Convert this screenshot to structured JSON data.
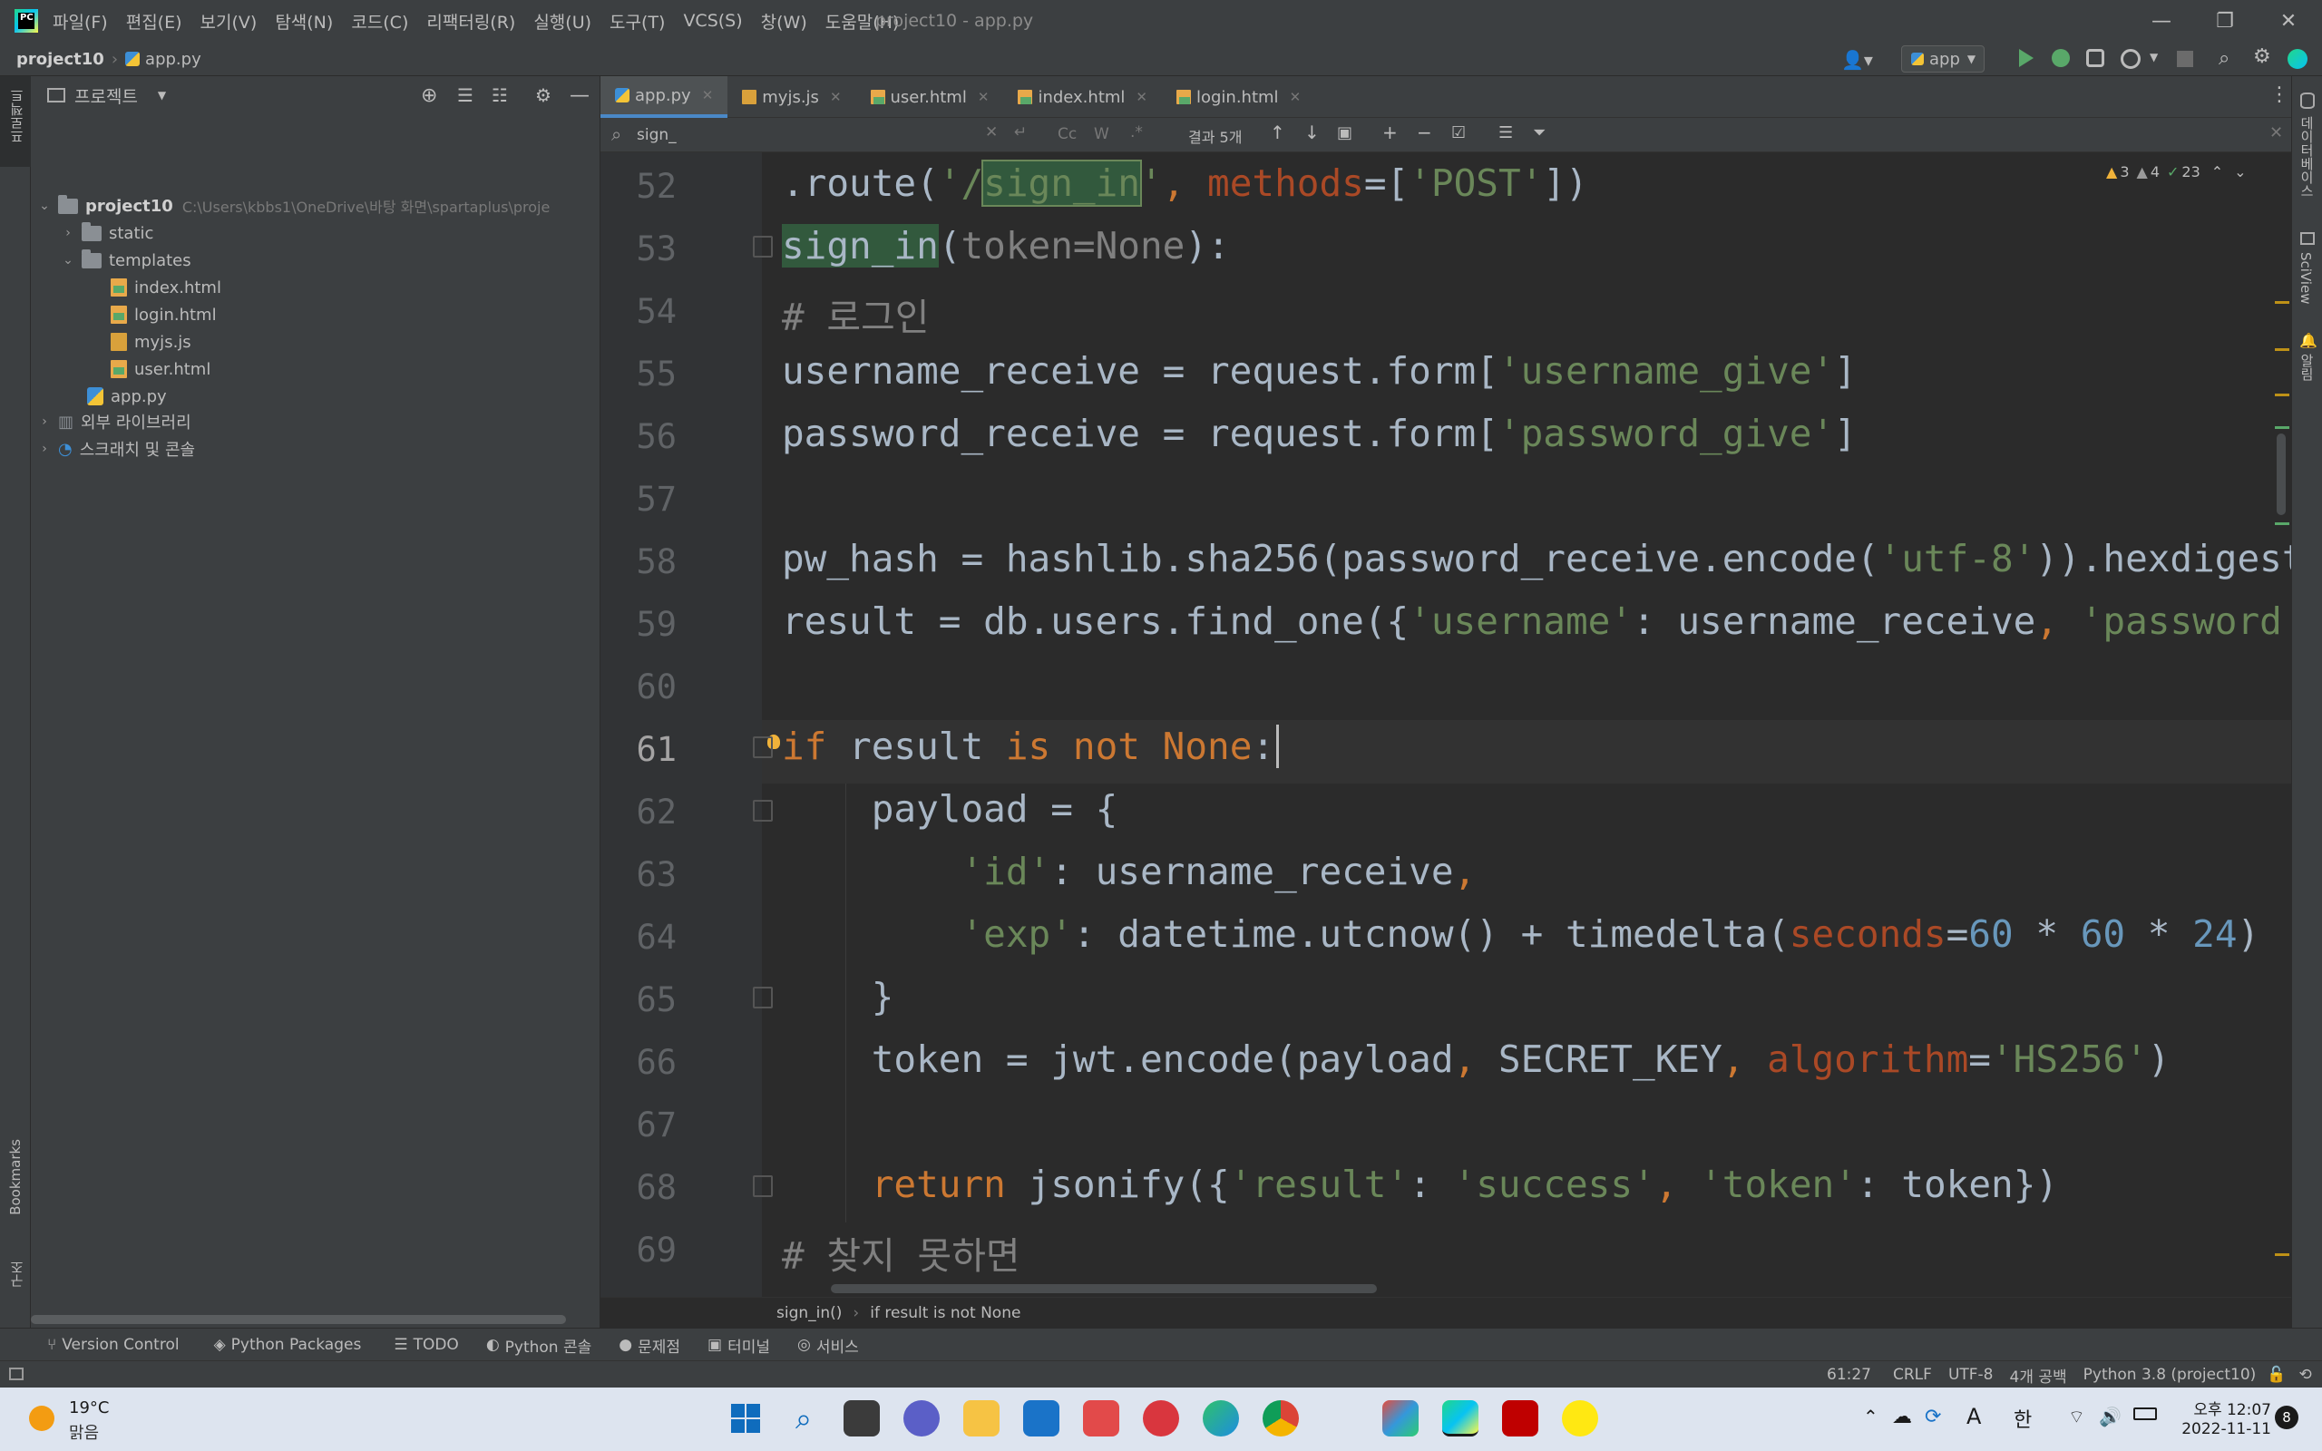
{
  "window": {
    "title": "project10 - app.py"
  },
  "menu": [
    "파일(F)",
    "편집(E)",
    "보기(V)",
    "탐색(N)",
    "코드(C)",
    "리팩터링(R)",
    "실행(U)",
    "도구(T)",
    "VCS(S)",
    "창(W)",
    "도움말(H)"
  ],
  "nav": {
    "project": "project10",
    "file": "app.py",
    "run_config": "app"
  },
  "project_panel": {
    "title": "프로젝트",
    "root_name": "project10",
    "root_path": "C:\\Users\\kbbs1\\OneDrive\\바탕 화면\\spartaplus\\proje",
    "items": [
      "static",
      "templates",
      "index.html",
      "login.html",
      "myjs.js",
      "user.html",
      "app.py",
      "외부 라이브러리",
      "스크래치 및 콘솔"
    ]
  },
  "left_strip": {
    "top": "프로젝트",
    "bookmarks": "Bookmarks",
    "structure": "구조"
  },
  "right_strip": {
    "db": "데이터베이스",
    "sciview": "SciView",
    "notify": "알림"
  },
  "tabs": [
    "app.py",
    "myjs.js",
    "user.html",
    "index.html",
    "login.html"
  ],
  "search": {
    "query": "sign_",
    "results": "결과 5개",
    "cc": "Cc",
    "w": "W",
    "regex": ".*"
  },
  "inspections": {
    "warnings": "3",
    "weak": "4",
    "ok": "23"
  },
  "editor": {
    "line_numbers": [
      "52",
      "53",
      "54",
      "55",
      "56",
      "57",
      "58",
      "59",
      "60",
      "61",
      "62",
      "63",
      "64",
      "65",
      "66",
      "67",
      "68",
      "69"
    ],
    "current_line": "61"
  },
  "breadcrumb": {
    "fn": "sign_in()",
    "block": "if result is not None"
  },
  "tool_windows": [
    "Version Control",
    "Python Packages",
    "TODO",
    "Python 콘솔",
    "문제점",
    "터미널",
    "서비스"
  ],
  "status": {
    "position": "61:27",
    "line_sep": "CRLF",
    "encoding": "UTF-8",
    "indent": "4개 공백",
    "interpreter": "Python 3.8 (project10)"
  },
  "taskbar": {
    "temp": "19°C",
    "weather": "맑음",
    "lang_a": "A",
    "ime": "한",
    "time": "오후 12:07",
    "date": "2022-11-11",
    "badge": "8"
  },
  "colors": {
    "keyword": "#cc7832",
    "string": "#6a8759",
    "number": "#6897bb",
    "comment": "#808080",
    "param": "#aa4926",
    "match_highlight": "#32593d"
  }
}
